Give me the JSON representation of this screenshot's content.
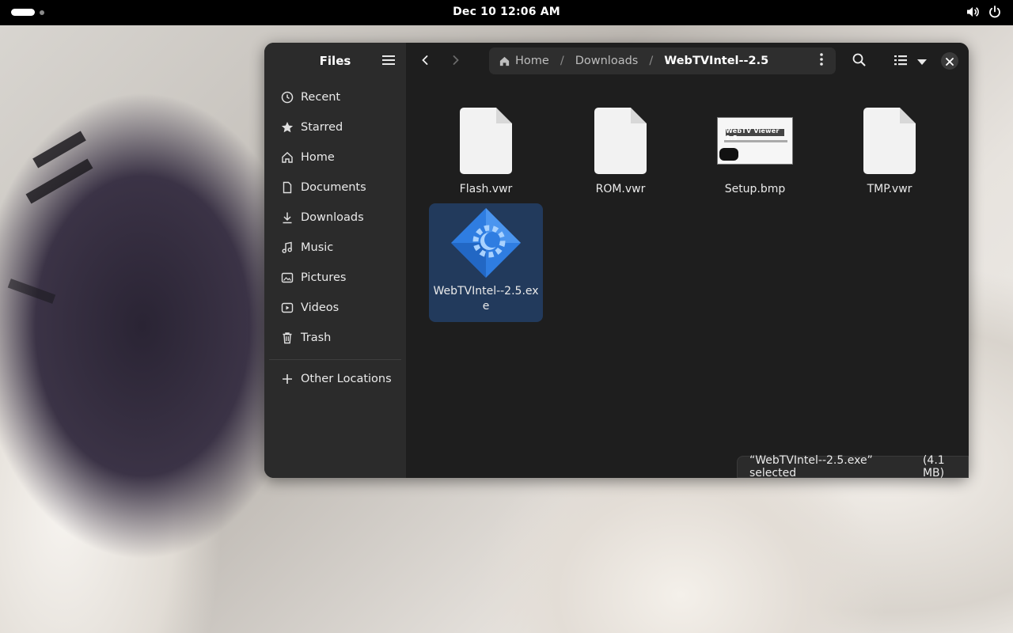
{
  "topbar": {
    "clock": "Dec 10  12:06 AM",
    "icons": [
      "volume-icon",
      "power-icon"
    ]
  },
  "window": {
    "app_title": "Files",
    "sidebar": {
      "places": [
        {
          "label": "Recent",
          "icon": "clock-icon"
        },
        {
          "label": "Starred",
          "icon": "star-icon"
        },
        {
          "label": "Home",
          "icon": "home-icon"
        },
        {
          "label": "Documents",
          "icon": "document-icon"
        },
        {
          "label": "Downloads",
          "icon": "download-icon"
        },
        {
          "label": "Music",
          "icon": "music-icon"
        },
        {
          "label": "Pictures",
          "icon": "picture-icon"
        },
        {
          "label": "Videos",
          "icon": "video-icon"
        },
        {
          "label": "Trash",
          "icon": "trash-icon"
        }
      ],
      "other_locations": "Other Locations"
    },
    "path": {
      "crumbs": [
        "Home",
        "Downloads",
        "WebTVIntel--2.5"
      ],
      "separator": "/"
    },
    "files": [
      {
        "name": "Flash.vwr",
        "kind": "document"
      },
      {
        "name": "ROM.vwr",
        "kind": "document"
      },
      {
        "name": "Setup.bmp",
        "kind": "image"
      },
      {
        "name": "TMP.vwr",
        "kind": "document"
      },
      {
        "name": "WebTVIntel--2.5.exe",
        "kind": "executable",
        "selected": true
      }
    ],
    "bmp_caption": "WebTV Viewer 2.5",
    "status": {
      "text": "“WebTVIntel--2.5.exe” selected",
      "size": "(4.1 MB)"
    },
    "colors": {
      "window_bg": "#1e1e1e",
      "sidebar_bg": "#2b2b2b",
      "selection": "#223a5c",
      "exe_icon": "#2f7de1"
    }
  }
}
